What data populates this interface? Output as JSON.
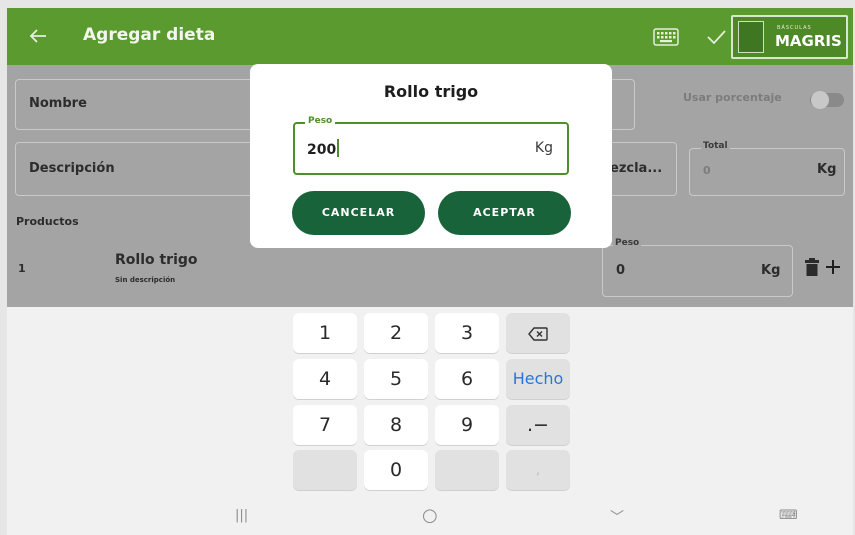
{
  "appbar": {
    "title": "Agregar dieta",
    "logo_top": "BÁSCULAS",
    "logo_brand": "MAGRIS"
  },
  "form": {
    "nombre_label": "Nombre",
    "usar_porcentaje_label": "Usar porcentaje",
    "descripcion_label": "Descripción",
    "mezcla_fragment": "ezcla...",
    "total_legend": "Total",
    "total_value": "0",
    "total_unit": "Kg",
    "productos_label": "Productos",
    "product_index": "1",
    "product_name": "Rollo trigo",
    "product_desc": "Sin descripción",
    "peso_legend": "Peso",
    "peso_value": "0",
    "peso_unit": "Kg"
  },
  "dialog": {
    "title": "Rollo trigo",
    "field_legend": "Peso",
    "value": "200",
    "unit": "Kg",
    "cancel": "CANCELAR",
    "accept": "ACEPTAR"
  },
  "keyboard": {
    "k1": "1",
    "k2": "2",
    "k3": "3",
    "k4": "4",
    "k5": "5",
    "k6": "6",
    "done": "Hecho",
    "k7": "7",
    "k8": "8",
    "k9": "9",
    "dotminus": ".−",
    "k0": "0",
    "comma": ","
  },
  "navbar": {
    "recents": "|||",
    "home": "○",
    "back": "﹀",
    "keyboard_toggle": "⌨"
  },
  "colors": {
    "appbar": "#5b9a2f",
    "accent_green": "#4f8f2b",
    "button_green": "#19633a",
    "done_blue": "#2677d9"
  }
}
